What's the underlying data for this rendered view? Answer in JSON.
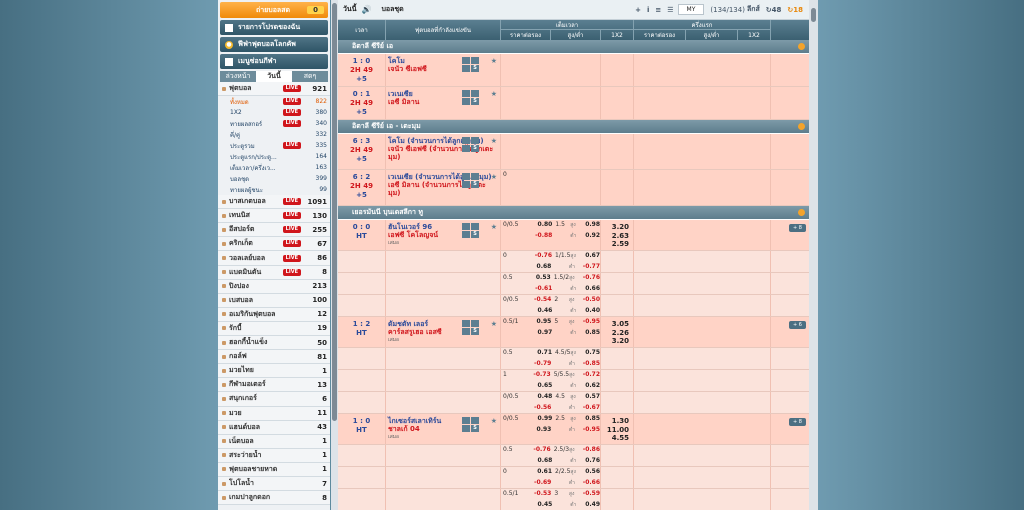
{
  "sidebar": {
    "betslip": {
      "label": "ถ่ายบอลสด",
      "count": "0"
    },
    "headers": [
      {
        "icon": "list-icon",
        "label": "รายการโปรดของฉัน"
      },
      {
        "icon": "trophy-icon",
        "label": "ฟีฟ่าฟุตบอลโลกคัพ"
      },
      {
        "icon": "menu-icon",
        "label": "เมนูซ่อนกีฬา"
      }
    ],
    "tabs": [
      "ล่วงหน้า",
      "วันนี้",
      "สดๆ"
    ],
    "active_tab": "วันนี้",
    "categories": [
      {
        "label": "ฟุตบอล",
        "live": true,
        "count": "921",
        "subs": [
          {
            "label": "ทั้งหมด",
            "live": true,
            "count": "822"
          },
          {
            "label": "1X2",
            "live": true,
            "count": "380"
          },
          {
            "label": "ทายผลสกอร์",
            "live": true,
            "count": "340"
          },
          {
            "label": "คี่/คู่",
            "live": false,
            "count": "332"
          },
          {
            "label": "ประตูรวม",
            "live": true,
            "count": "335"
          },
          {
            "label": "ประตูแรก/ประตู...",
            "live": false,
            "count": "164"
          },
          {
            "label": "เต็มเวลา/ครึ่งเว...",
            "live": false,
            "count": "163"
          },
          {
            "label": "บอลชุด",
            "live": false,
            "count": "399"
          },
          {
            "label": "ทายผลผู้ชนะ",
            "live": false,
            "count": "99"
          }
        ]
      },
      {
        "label": "บาสเกตบอล",
        "live": true,
        "count": "1091"
      },
      {
        "label": "เทนนิส",
        "live": true,
        "count": "130"
      },
      {
        "label": "อีสปอร์ต",
        "live": true,
        "count": "255"
      },
      {
        "label": "คริกเก็ต",
        "live": true,
        "count": "67"
      },
      {
        "label": "วอลเลย์บอล",
        "live": true,
        "count": "86"
      },
      {
        "label": "แบดมินตัน",
        "live": true,
        "count": "8"
      },
      {
        "label": "ปิงปอง",
        "live": false,
        "count": "213"
      },
      {
        "label": "เบสบอล",
        "live": false,
        "count": "100"
      },
      {
        "label": "อเมริกันฟุตบอล",
        "live": false,
        "count": "12"
      },
      {
        "label": "รักบี้",
        "live": false,
        "count": "19"
      },
      {
        "label": "ฮอกกี้น้ำแข็ง",
        "live": false,
        "count": "50"
      },
      {
        "label": "กอล์ฟ",
        "live": false,
        "count": "81"
      },
      {
        "label": "มวยไทย",
        "live": false,
        "count": "1"
      },
      {
        "label": "กีฬามอเตอร์",
        "live": false,
        "count": "13"
      },
      {
        "label": "สนุกเกอร์",
        "live": false,
        "count": "6"
      },
      {
        "label": "มวย",
        "live": false,
        "count": "11"
      },
      {
        "label": "แฮนด์บอล",
        "live": false,
        "count": "43"
      },
      {
        "label": "เน็ตบอล",
        "live": false,
        "count": "1"
      },
      {
        "label": "สระว่ายน้ำ",
        "live": false,
        "count": "1"
      },
      {
        "label": "ฟุตบอลชายหาด",
        "live": false,
        "count": "1"
      },
      {
        "label": "โปโลน้ำ",
        "live": false,
        "count": "7"
      },
      {
        "label": "เกมปาลูกดอก",
        "live": false,
        "count": "8"
      }
    ]
  },
  "toolbar": {
    "title": "วันนี้",
    "subtitle": "บอลชุด",
    "plus": "+",
    "info": "i",
    "odds_type": "MY",
    "count": "(134/134)",
    "league_label": "ลีกส์",
    "refresh1": "48",
    "refresh2": "18"
  },
  "table_header": {
    "time": "เวลา",
    "event": "ฟุตบอลที่กำลังแข่งขัน",
    "full_time": "เต็มเวลา",
    "first_half": "ครึ่งแรก",
    "hdp": "ราคาต่อรอง",
    "ou": "สูง/ต่ำ",
    "x12": "1X2"
  },
  "leagues": [
    {
      "name": "อิตาลี ซีรีย์ เอ",
      "matches": [
        {
          "score": "1 : 0",
          "period": "2H 49",
          "extra": "+5",
          "home": "โคโม",
          "away": "เจนัว ซีเอฟซี",
          "draw": "",
          "hdp": "",
          "odds": []
        },
        {
          "score": "0 : 1",
          "period": "2H 49",
          "extra": "+5",
          "home": "เวเนเซีย",
          "away": "เอซี มิลาน",
          "draw": "",
          "hdp": "",
          "odds": []
        }
      ]
    },
    {
      "name": "อิตาลี ซีรีย์ เอ - เตะมุม",
      "matches": [
        {
          "score": "6 : 3",
          "period": "2H 49",
          "extra": "+5",
          "home": "โคโม (จำนวนการได้ลูกเตะมุม)",
          "away": "เจนัว ซีเอฟซี (จำนวนการได้ลูกเตะมุม)",
          "draw": "",
          "hdp": "",
          "odds": []
        },
        {
          "score": "6 : 2",
          "period": "2H 49",
          "extra": "+5",
          "home": "เวเนเซีย (จำนวนการได้ลูกเตะมุม)",
          "away": "เอซี มิลาน (จำนวนการได้ลูกเตะมุม)",
          "draw": "",
          "hdp": "0",
          "odds": []
        }
      ]
    },
    {
      "name": "เยอรมันนี บุนเดสลีกา ทู",
      "matches": [
        {
          "score": "0 : 0",
          "period": "HT",
          "extra": "",
          "home": "ฮันโนเวอร์ 96",
          "away": "เอฟซี โคโลญจน์",
          "draw": "เสมอ",
          "more": "+ 8",
          "x12": [
            "3.20",
            "2.63",
            "2.59"
          ],
          "odds": [
            {
              "hdp": "0/0.5",
              "o1": "0.80",
              "o2": "-0.88",
              "ln": "1.5",
              "u1": "0.98",
              "u2": "0.92"
            },
            {
              "hdp": "0",
              "o1": "-0.76",
              "o2": "0.68",
              "ln": "1/1.5",
              "u1": "0.67",
              "u2": "-0.77"
            },
            {
              "hdp": "0.5",
              "o1": "0.53",
              "o2": "-0.61",
              "ln": "1.5/2",
              "u1": "-0.76",
              "u2": "0.66"
            },
            {
              "hdp": "0/0.5",
              "o1": "-0.54",
              "o2": "0.46",
              "ln": "2",
              "u1": "-0.50",
              "u2": "0.40"
            }
          ]
        },
        {
          "score": "1 : 2",
          "period": "HT",
          "extra": "",
          "home": "ดัมชตัท เลอร์",
          "away": "คาร์ลสรูเฮอ เอสซี",
          "draw": "เสมอ",
          "more": "+ 6",
          "x12": [
            "3.05",
            "2.26",
            "3.20"
          ],
          "odds": [
            {
              "hdp": "0.5/1",
              "o1": "0.95",
              "o2": "0.97",
              "ln": "5",
              "u1": "-0.95",
              "u2": "0.85"
            },
            {
              "hdp": "0.5",
              "o1": "0.71",
              "o2": "-0.79",
              "ln": "4.5/5",
              "u1": "0.75",
              "u2": "-0.85"
            },
            {
              "hdp": "1",
              "o1": "-0.73",
              "o2": "0.65",
              "ln": "5/5.5",
              "u1": "-0.72",
              "u2": "0.62"
            },
            {
              "hdp": "0/0.5",
              "o1": "0.48",
              "o2": "-0.56",
              "ln": "4.5",
              "u1": "0.57",
              "u2": "-0.67"
            }
          ]
        },
        {
          "score": "1 : 0",
          "period": "HT",
          "extra": "",
          "home": "ไกเซอร์สเลาเทิร์น",
          "away": "ชาลเก้ 04",
          "draw": "เสมอ",
          "more": "+ 8",
          "x12": [
            "1.30",
            "11.00",
            "4.55"
          ],
          "odds": [
            {
              "hdp": "0/0.5",
              "o1": "0.99",
              "o2": "0.93",
              "ln": "2.5",
              "u1": "0.85",
              "u2": "-0.95"
            },
            {
              "hdp": "0.5",
              "o1": "-0.76",
              "o2": "0.68",
              "ln": "2.5/3",
              "u1": "-0.86",
              "u2": "0.76"
            },
            {
              "hdp": "0",
              "o1": "0.61",
              "o2": "-0.69",
              "ln": "2/2.5",
              "u1": "0.56",
              "u2": "-0.66"
            },
            {
              "hdp": "0.5/1",
              "o1": "-0.53",
              "o2": "0.45",
              "ln": "3",
              "u1": "-0.59",
              "u2": "0.49"
            }
          ]
        }
      ]
    }
  ],
  "labels": {
    "over": "สูง",
    "under": "ต่ำ"
  }
}
